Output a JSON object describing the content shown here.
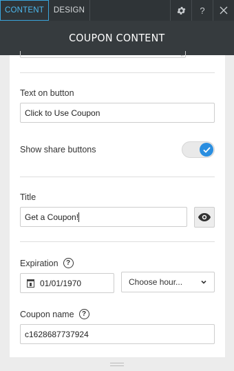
{
  "tabs": {
    "content": "CONTENT",
    "design": "DESIGN"
  },
  "top_icons": {
    "settings": "gear-icon",
    "help": "?",
    "close": "close-icon"
  },
  "header": {
    "title": "COUPON CONTENT"
  },
  "fields": {
    "button_text": {
      "label": "Text on button",
      "value": "Click to Use Coupon"
    },
    "share": {
      "label": "Show share buttons",
      "checked": true
    },
    "title": {
      "label": "Title",
      "value": "Get a Coupon!"
    },
    "expiration": {
      "label": "Expiration",
      "help": "?",
      "date": "01/01/1970",
      "hour_placeholder": "Choose hour..."
    },
    "coupon_name": {
      "label": "Coupon name",
      "help": "?",
      "value": "c1628687737924"
    }
  },
  "colors": {
    "accent": "#2a8ee0",
    "tab_active": "#4cb8ee",
    "topbar": "#2f3437",
    "header": "#363b3e"
  }
}
